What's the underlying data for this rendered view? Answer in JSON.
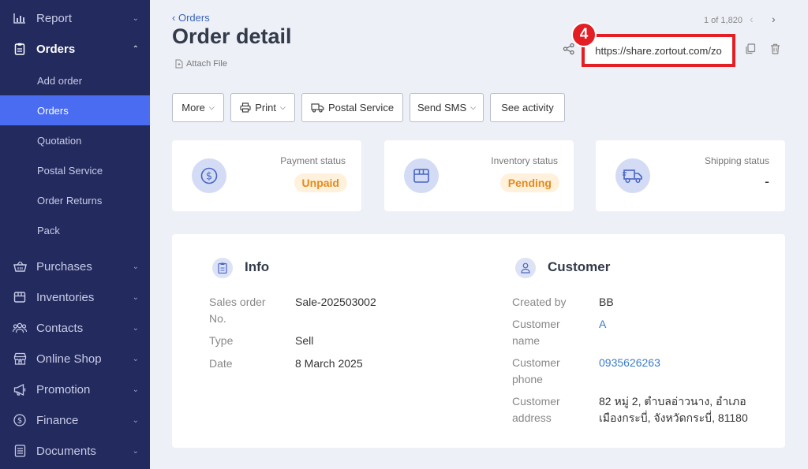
{
  "sidebar": {
    "report": "Report",
    "orders": "Orders",
    "sub": [
      "Add order",
      "Orders",
      "Quotation",
      "Postal Service",
      "Order Returns",
      "Pack"
    ],
    "purchases": "Purchases",
    "inventories": "Inventories",
    "contacts": "Contacts",
    "online_shop": "Online Shop",
    "promotion": "Promotion",
    "finance": "Finance",
    "documents": "Documents"
  },
  "header": {
    "breadcrumb": "Orders",
    "title": "Order detail",
    "attach": "Attach File",
    "pager": "1 of 1,820",
    "share_url": "https://share.zortout.com/zo",
    "step_badge": "4"
  },
  "toolbar": {
    "more": "More",
    "print": "Print",
    "postal": "Postal Service",
    "sms": "Send SMS",
    "activity": "See activity"
  },
  "status": {
    "payment_label": "Payment status",
    "payment_value": "Unpaid",
    "inventory_label": "Inventory status",
    "inventory_value": "Pending",
    "shipping_label": "Shipping status",
    "shipping_value": "-"
  },
  "info": {
    "title": "Info",
    "sales_order_label": "Sales order No.",
    "sales_order_value": "Sale-202503002",
    "type_label": "Type",
    "type_value": "Sell",
    "date_label": "Date",
    "date_value": "8 March 2025"
  },
  "customer": {
    "title": "Customer",
    "created_by_label": "Created by",
    "created_by_value": "BB",
    "name_label": "Customer name",
    "name_value": "A",
    "phone_label": "Customer phone",
    "phone_value": "0935626263",
    "address_label": "Customer address",
    "address_line1": "82 หมู่ 2, ตำบลอ่าวนาง, อำเภอ",
    "address_line2": "เมืองกระบี่, จังหวัดกระบี่, 81180"
  },
  "colors": {
    "sidebar_bg": "#232a5e",
    "active_item": "#4a6cf0",
    "highlight_red": "#e31e24",
    "pending_orange": "#e38a1c"
  }
}
